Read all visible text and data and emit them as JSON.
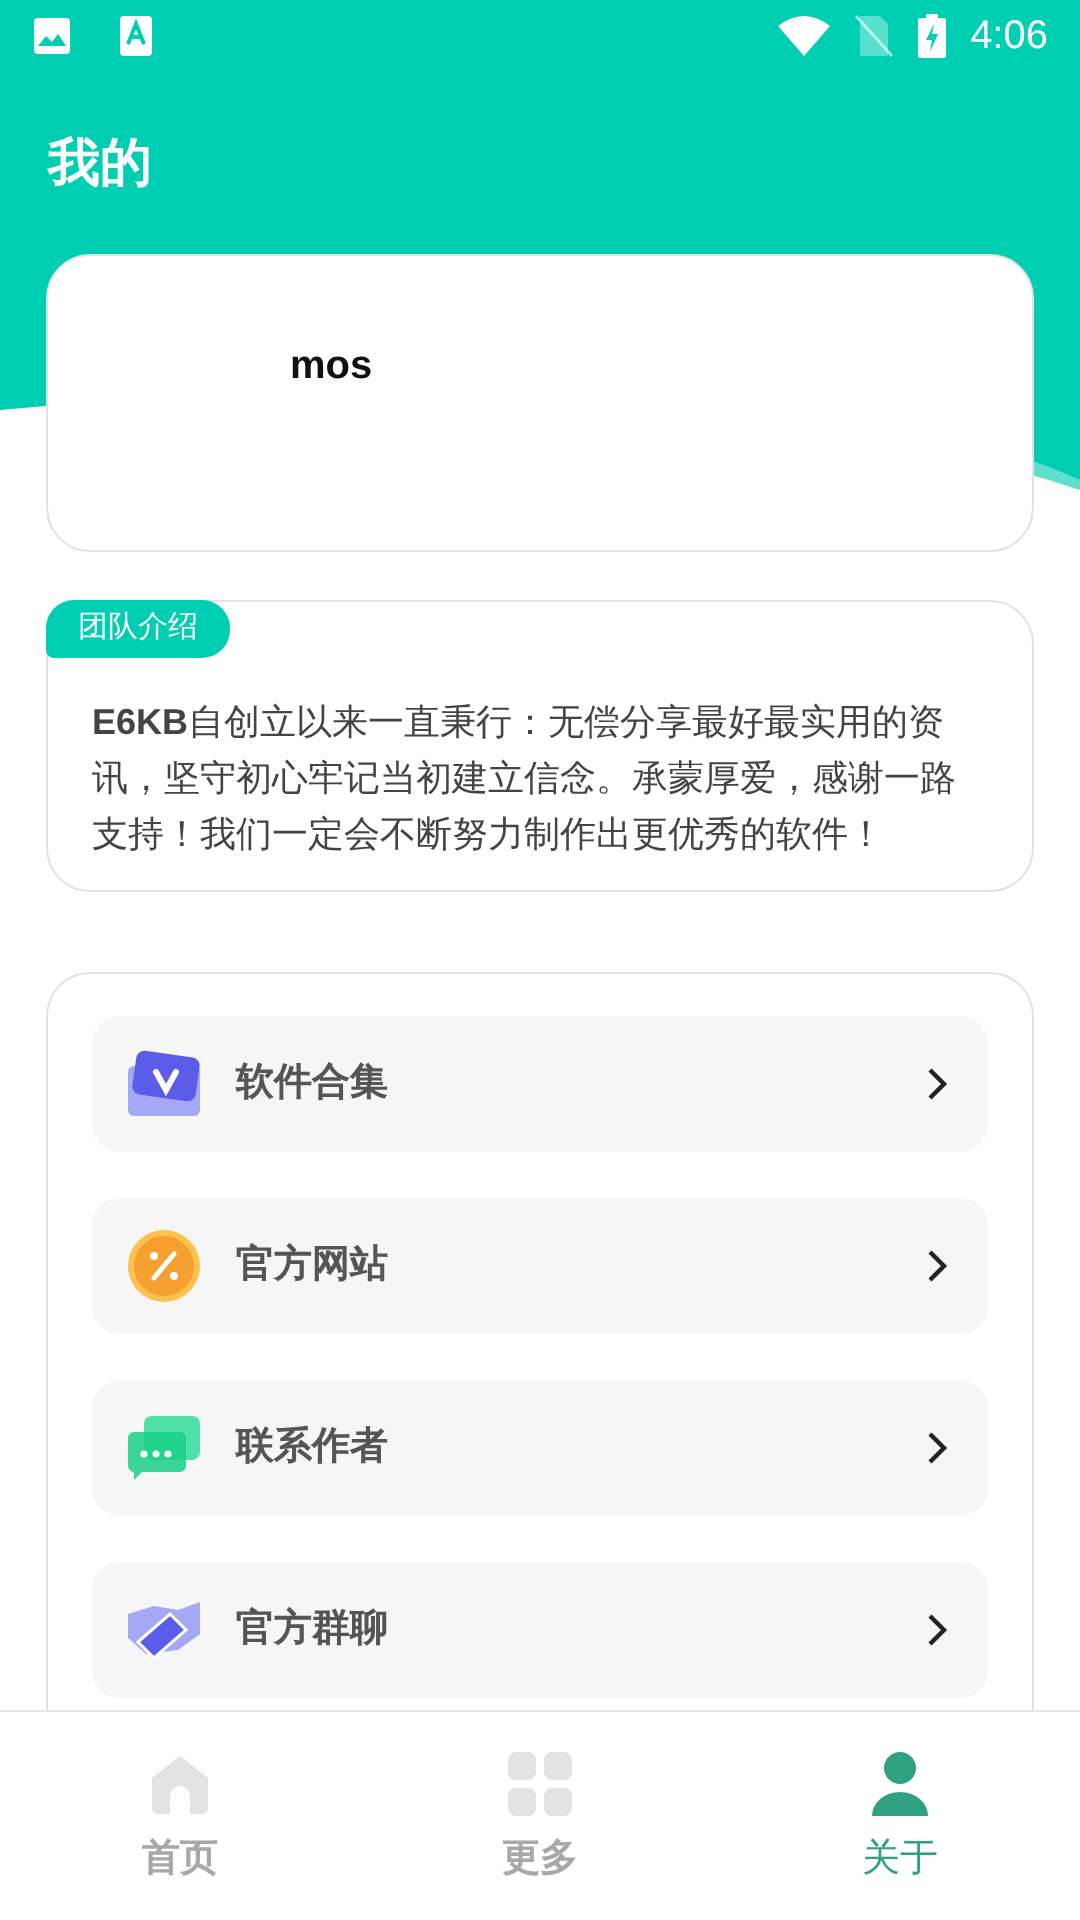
{
  "status_bar": {
    "time": "4:06"
  },
  "header": {
    "title": "我的"
  },
  "profile": {
    "name": "mos"
  },
  "team": {
    "tag": "团队介绍",
    "text": "**E6KB**自创立以来一直秉行：无偿分享最好最实用的资讯，坚守初心牢记当初建立信念。承蒙厚爱，感谢一路支持！我们一定会不断努力制作出更优秀的软件！"
  },
  "menu": [
    {
      "kind": "collection",
      "label": "软件合集"
    },
    {
      "kind": "website",
      "label": "官方网站"
    },
    {
      "kind": "contact",
      "label": "联系作者"
    },
    {
      "kind": "group",
      "label": "官方群聊"
    }
  ],
  "tabs": [
    {
      "kind": "home",
      "label": "首页",
      "selected": false
    },
    {
      "kind": "more",
      "label": "更多",
      "selected": false
    },
    {
      "kind": "about",
      "label": "关于",
      "selected": true
    }
  ]
}
